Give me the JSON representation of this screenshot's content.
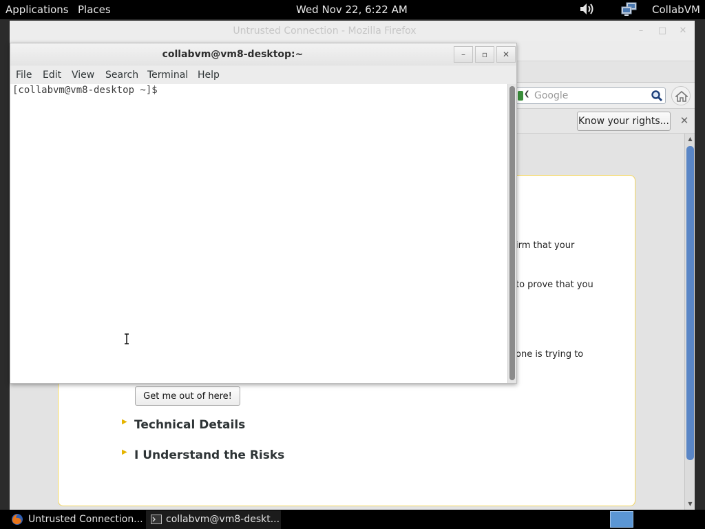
{
  "top_panel": {
    "applications_label": "Applications",
    "places_label": "Places",
    "clock": "Wed Nov 22,  6:22 AM",
    "user_label": "CollabVM",
    "icons": [
      "volume-icon",
      "network-icon"
    ]
  },
  "firefox": {
    "window_title": "Untrusted Connection - Mozilla Firefox",
    "search_placeholder": "Google",
    "notification_button": "Know your rights...",
    "page": {
      "visible_fragments": [
        "irm that your",
        "to prove that you",
        "one is trying to"
      ],
      "escape_button": "Get me out of here!",
      "technical_details_label": "Technical Details",
      "understand_risks_label": "I Understand the Risks"
    },
    "colors": {
      "box_border": "#f2d55e",
      "expander_arrow": "#e5b400",
      "scroll_thumb": "#5a86c6"
    }
  },
  "terminal": {
    "title": "collabvm@vm8-desktop:~",
    "menu": {
      "file": "File",
      "edit": "Edit",
      "view": "View",
      "search": "Search",
      "terminal": "Terminal",
      "help": "Help"
    },
    "prompt": "[collabvm@vm8-desktop ~]$ "
  },
  "taskbar": {
    "items": [
      {
        "label": "Untrusted Connection...",
        "icon": "firefox-icon"
      },
      {
        "label": "collabvm@vm8-deskt...",
        "icon": "terminal-icon"
      }
    ]
  }
}
